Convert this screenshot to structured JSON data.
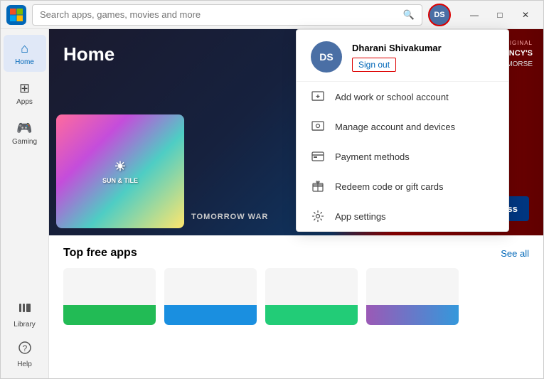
{
  "titlebar": {
    "search_placeholder": "Search apps, games, movies and more",
    "user_initials": "DS",
    "window_controls": {
      "minimize": "—",
      "maximize": "□",
      "close": "✕"
    }
  },
  "sidebar": {
    "items": [
      {
        "label": "Home",
        "icon": "⌂",
        "active": true
      },
      {
        "label": "Apps",
        "icon": "⊞",
        "active": false
      },
      {
        "label": "Gaming",
        "icon": "🎮",
        "active": false
      },
      {
        "label": "Library",
        "icon": "≡",
        "active": false
      },
      {
        "label": "Help",
        "icon": "?",
        "active": false
      }
    ]
  },
  "hero": {
    "title": "Home",
    "tomorrow_war": "TOMORROW WAR",
    "pc_game_pass": "PC Game Pass",
    "amazon_original": "AMAZON ORIGINAL",
    "tom_clancy": "TOM CLANCY'S",
    "without_remorse": "WITHOUT REMORSE"
  },
  "top_free_apps": {
    "title": "Top free apps",
    "see_all": "See all"
  },
  "dropdown": {
    "user_name": "Dharani Shivakumar",
    "user_initials": "DS",
    "sign_out": "Sign out",
    "items": [
      {
        "label": "Add work or school account",
        "icon": "monitor"
      },
      {
        "label": "Manage account and devices",
        "icon": "settings-monitor"
      },
      {
        "label": "Payment methods",
        "icon": "card"
      },
      {
        "label": "Redeem code or gift cards",
        "icon": "gift"
      },
      {
        "label": "App settings",
        "icon": "gear"
      }
    ]
  },
  "colors": {
    "accent": "#0067b8",
    "red_border": "#cc0000",
    "sidebar_bg": "#f3f3f3",
    "avatar_bg": "#4a6fa5"
  }
}
